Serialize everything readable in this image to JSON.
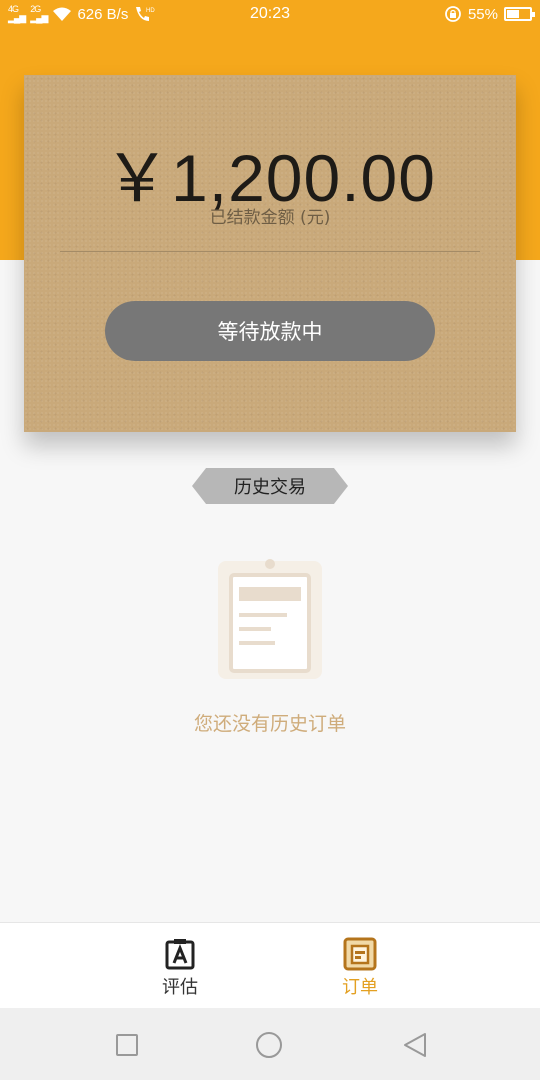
{
  "status_bar": {
    "network_left": "4G",
    "network_right": "2G",
    "speed": "626 B/s",
    "hd_label": "HD",
    "time": "20:23",
    "battery": "55%",
    "battery_level": 0.55
  },
  "balance_card": {
    "amount": "￥1,200.00",
    "amount_label": "已结款金额 (元)",
    "status_button": "等待放款中"
  },
  "history": {
    "tag_label": "历史交易",
    "empty_message": "您还没有历史订单"
  },
  "tabs": [
    {
      "label": "评估",
      "icon": "assess-icon",
      "active": false
    },
    {
      "label": "订单",
      "icon": "orders-icon",
      "active": true
    }
  ],
  "colors": {
    "accent": "#f5a81c",
    "card": "#c9a97a",
    "active_tab": "#e3a022",
    "button": "#777777",
    "empty_text": "#cfac7b"
  },
  "nav": {
    "recent": "recent-apps-icon",
    "home": "home-icon",
    "back": "back-icon"
  }
}
